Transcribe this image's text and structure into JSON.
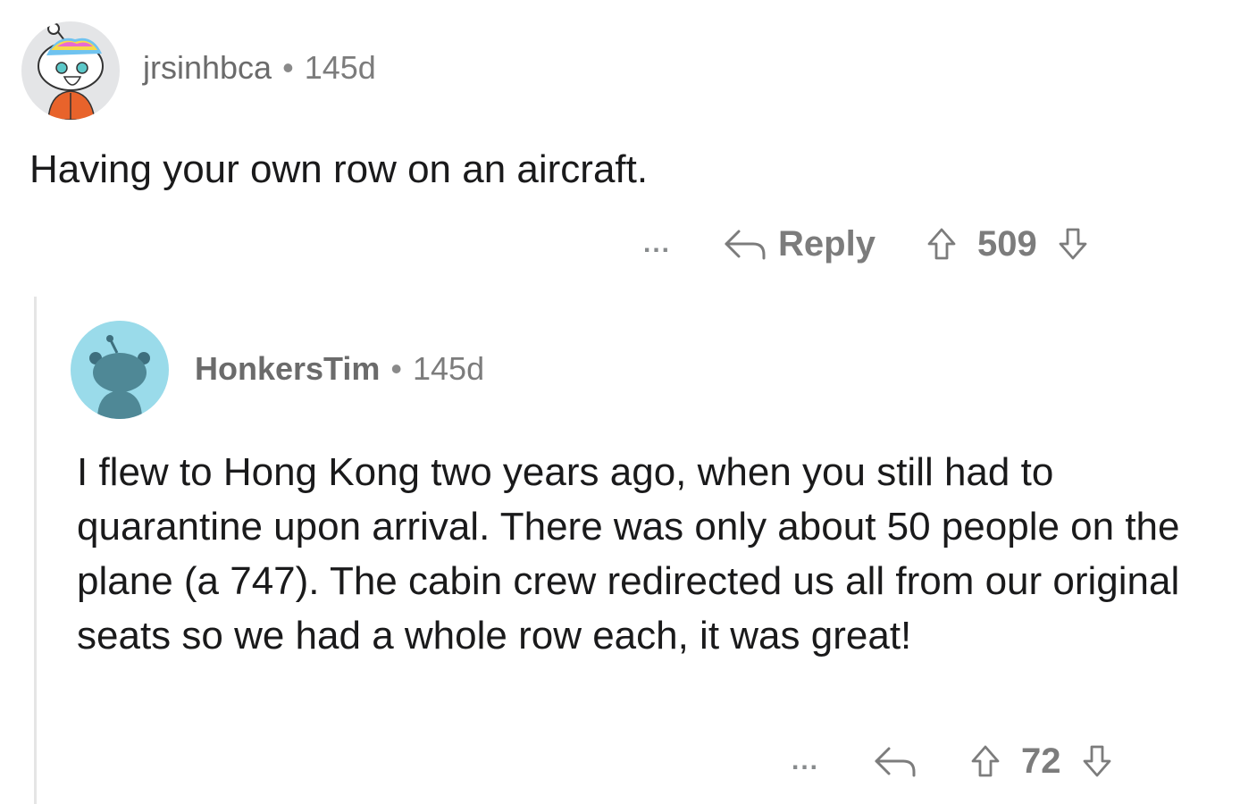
{
  "comments": [
    {
      "username": "jrsinhbca",
      "separator": "•",
      "age": "145d",
      "body": "Having your own row on an aircraft.",
      "more_label": "...",
      "reply_label": "Reply",
      "score": "509"
    },
    {
      "username": "HonkersTim",
      "separator": "•",
      "age": "145d",
      "body": "I flew to Hong Kong two years ago, when you still had to quarantine upon arrival. There was only about 50 people on the plane (a 747). The cabin crew redirected us all from our original seats so we had a whole row each, it was great!",
      "more_label": "...",
      "score": "72"
    }
  ],
  "icons": {
    "reply": "reply-arrow-icon",
    "upvote": "upvote-arrow-icon",
    "downvote": "downvote-arrow-icon"
  },
  "colors": {
    "meta_text": "#7c7c7c",
    "body_text": "#1a1a1b",
    "avatar_reply_bg": "#9adbea",
    "thread_line": "#e5e5e5"
  }
}
